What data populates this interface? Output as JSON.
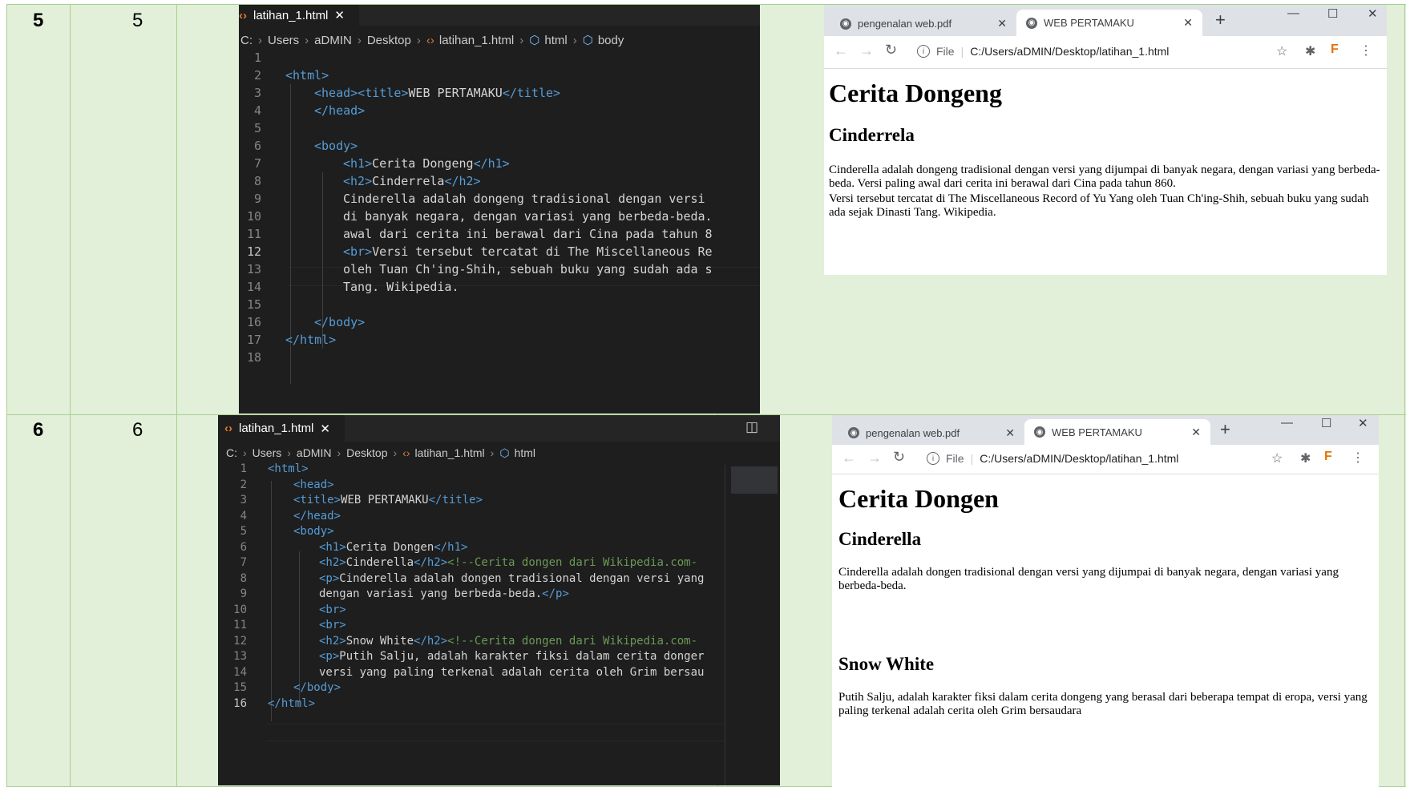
{
  "rows": [
    {
      "col1": "5",
      "col2": "5",
      "editor": {
        "tab_label": "latihan_1.html",
        "breadcrumb": [
          "C:",
          "Users",
          "aDMIN",
          "Desktop",
          "latihan_1.html",
          "html",
          "body"
        ],
        "current_line": "12",
        "lines": [
          "1",
          "2",
          "3",
          "4",
          "5",
          "6",
          "7",
          "8",
          "9",
          "10",
          "11",
          "12",
          "13",
          "14",
          "15",
          "16",
          "17",
          "18"
        ],
        "code": {
          "l2": "<html>",
          "l3a": "<head><title>",
          "l3b": "WEB PERTAMAKU",
          "l3c": "</title>",
          "l4": "</head>",
          "l6": "<body>",
          "l7a": "<h1>",
          "l7b": "Cerita Dongeng",
          "l7c": "</h1>",
          "l8a": "<h2>",
          "l8b": "Cinderrela",
          "l8c": "</h2>",
          "l9": "Cinderella adalah dongeng tradisional dengan versi",
          "l10": "di banyak negara, dengan variasi yang berbeda-beda.",
          "l11": "awal dari cerita ini berawal dari Cina pada tahun 8",
          "l12a": "<br>",
          "l12b": "Versi tersebut tercatat di The Miscellaneous Re",
          "l13": "oleh Tuan Ch'ing-Shih, sebuah buku yang sudah ada s",
          "l14": "Tang. Wikipedia.",
          "l16": "</body>",
          "l17": "</html>"
        }
      },
      "browser": {
        "tabs": [
          {
            "label": "pengenalan web.pdf",
            "active": false
          },
          {
            "label": "WEB PERTAMAKU",
            "active": true
          }
        ],
        "url_scheme": "File",
        "url": "C:/Users/aDMIN/Desktop/latihan_1.html",
        "page": {
          "h1": "Cerita Dongeng",
          "h2": "Cinderrela",
          "p1": "Cinderella adalah dongeng tradisional dengan versi yang dijumpai di banyak negara, dengan variasi yang berbeda-beda. Versi paling awal dari cerita ini berawal dari Cina pada tahun 860.",
          "p2": "Versi tersebut tercatat di The Miscellaneous Record of Yu Yang oleh Tuan Ch'ing-Shih, sebuah buku yang sudah ada sejak Dinasti Tang. Wikipedia."
        }
      }
    },
    {
      "col1": "6",
      "col2": "6",
      "editor": {
        "tab_label": "latihan_1.html",
        "breadcrumb": [
          "C:",
          "Users",
          "aDMIN",
          "Desktop",
          "latihan_1.html",
          "html"
        ],
        "current_line": "16",
        "lines": [
          "1",
          "2",
          "3",
          "4",
          "5",
          "6",
          "7",
          "8",
          "9",
          "10",
          "11",
          "12",
          "13",
          "14",
          "15",
          "16"
        ],
        "code": {
          "l1": "<html>",
          "l2": "<head>",
          "l3a": "<title>",
          "l3b": "WEB PERTAMAKU",
          "l3c": "</title>",
          "l4": "</head>",
          "l5": "<body>",
          "l6a": "<h1>",
          "l6b": "Cerita Dongen",
          "l6c": "</h1>",
          "l7a": "<h2>",
          "l7b": "Cinderella",
          "l7c": "</h2>",
          "l7d": "<!--Cerita dongen dari Wikipedia.com-",
          "l8a": "<p>",
          "l8b": "Cinderella adalah dongen tradisional dengan versi yang",
          "l9a": "dengan variasi yang berbeda-beda.",
          "l9b": "</p>",
          "l10": "<br>",
          "l11": "<br>",
          "l12a": "<h2>",
          "l12b": "Snow White",
          "l12c": "</h2>",
          "l12d": "<!--Cerita dongen dari Wikipedia.com-",
          "l13a": "<p>",
          "l13b": "Putih Salju, adalah karakter fiksi dalam cerita donger",
          "l14": "versi yang paling terkenal adalah cerita oleh Grim bersau",
          "l15": "</body>",
          "l16": "</html>"
        }
      },
      "browser": {
        "tabs": [
          {
            "label": "pengenalan web.pdf",
            "active": false
          },
          {
            "label": "WEB PERTAMAKU",
            "active": true
          }
        ],
        "url_scheme": "File",
        "url": "C:/Users/aDMIN/Desktop/latihan_1.html",
        "page": {
          "h1": "Cerita Dongen",
          "h2a": "Cinderella",
          "p1": "Cinderella adalah dongen tradisional dengan versi yang dijumpai di banyak negara, dengan variasi yang berbeda-beda.",
          "h2b": "Snow White",
          "p2": "Putih Salju, adalah karakter fiksi dalam cerita dongeng yang berasal dari beberapa tempat di eropa, versi yang paling terkenal adalah cerita oleh Grim bersaudara"
        }
      }
    }
  ],
  "icons": {
    "file_html": "‹›",
    "close": "✕",
    "chevron": "›",
    "cube": "⬡",
    "globe": "◉",
    "back": "←",
    "forward": "→",
    "reload": "↻",
    "star": "☆",
    "puzzle": "✱",
    "menu": "⋮",
    "split": "◫"
  },
  "colors": {
    "table_bg": "#e2efd9",
    "table_border": "#a8d08d",
    "editor_bg": "#1e1e1e",
    "tag_blue": "#569cd6",
    "comment_green": "#6a9955"
  }
}
